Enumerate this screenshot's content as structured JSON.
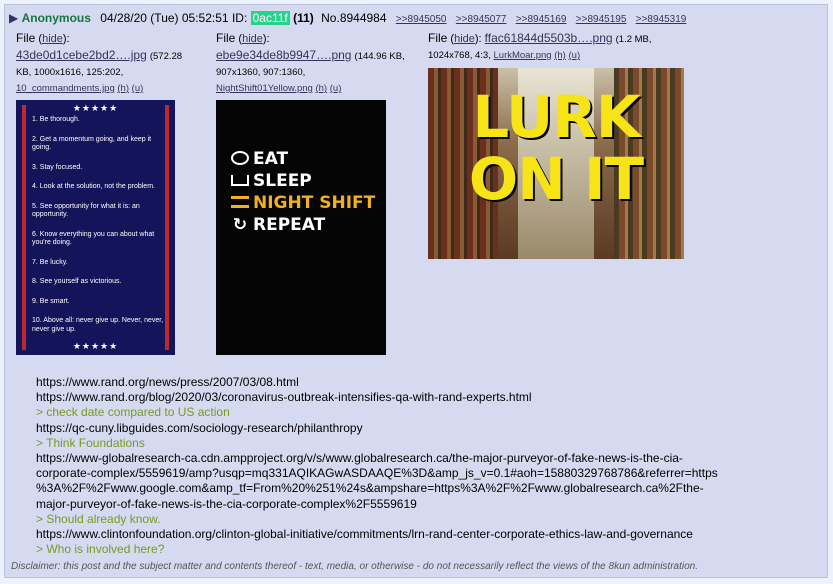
{
  "header": {
    "name": "Anonymous",
    "datetime": "04/28/20 (Tue) 05:52:51",
    "id_label": "ID:",
    "id": "0ac11f",
    "count": "(11)",
    "number": "No.8944984",
    "backlinks": [
      ">>8945050",
      ">>8945077",
      ">>8945169",
      ">>8945195",
      ">>8945319"
    ]
  },
  "files": [
    {
      "label": "File",
      "hide": "hide",
      "filename": "43de0d1cebe2bd2….jpg",
      "meta1": "(572.28",
      "meta2": "KB, 1000x1616, 125:202,",
      "orig": "10_commandments.jpg",
      "h": "(h)",
      "u": "(u)",
      "list": [
        "1. Be thorough.",
        "2. Get a momentum going, and keep it going.",
        "3. Stay focused.",
        "4. Look at the solution, not the problem.",
        "5. See opportunity for what it is: an opportunity.",
        "6. Know everything you can about what you're doing.",
        "7. Be lucky.",
        "8. See yourself as victorious.",
        "9. Be smart.",
        "10. Above all: never give up. Never, never, never give up."
      ],
      "stars": "★★★★★"
    },
    {
      "label": "File",
      "hide": "hide",
      "filename": "ebe9e34de8b9947….png",
      "meta1": "(144.96 KB,",
      "meta2": "907x1360, 907:1360,",
      "orig": "NightShift01Yellow.png",
      "h": "(h)",
      "u": "(u)",
      "lines": [
        "EAT",
        "SLEEP",
        "NIGHT SHIFT",
        "REPEAT"
      ]
    },
    {
      "label": "File",
      "hide": "hide",
      "filename": "ffac61844d5503b….png",
      "meta1": "(1.2 MB,",
      "meta2": "1024x768, 4:3,",
      "orig": "LurkMoar.png",
      "h": "(h)",
      "u": "(u)",
      "line1": "LURK",
      "line2": "ON IT"
    }
  ],
  "body_lines": [
    {
      "text": "https://www.rand.org/news/press/2007/03/08.html",
      "quote": false
    },
    {
      "text": "https://www.rand.org/blog/2020/03/coronavirus-outbreak-intensifies-qa-with-rand-experts.html",
      "quote": false
    },
    {
      "text": "> check date compared to US action",
      "quote": true
    },
    {
      "text": "https://qc-cuny.libguides.com/sociology-research/philanthropy",
      "quote": false
    },
    {
      "text": "> Think Foundations",
      "quote": true
    },
    {
      "text": "https://www-globalresearch-ca.cdn.ampproject.org/v/s/www.globalresearch.ca/the-major-purveyor-of-fake-news-is-the-cia-",
      "quote": false
    },
    {
      "text": "corporate-complex/5559619/amp?usqp=mq331AQIKAGwASDAAQE%3D&amp_js_v=0.1#aoh=15880329768786&referrer=https",
      "quote": false
    },
    {
      "text": "%3A%2F%2Fwww.google.com&amp_tf=From%20%251%24s&ampshare=https%3A%2F%2Fwww.globalresearch.ca%2Fthe-",
      "quote": false
    },
    {
      "text": "major-purveyor-of-fake-news-is-the-cia-corporate-complex%2F5559619",
      "quote": false
    },
    {
      "text": "> Should already know.",
      "quote": true
    },
    {
      "text": "https://www.clintonfoundation.org/clinton-global-initiative/commitments/lrn-rand-center-corporate-ethics-law-and-governance",
      "quote": false
    },
    {
      "text": "> Who is involved here?",
      "quote": true
    }
  ],
  "disclaimer": "Disclaimer: this post and the subject matter and contents thereof - text, media, or otherwise - do not necessarily reflect the views of the 8kun administration.",
  "colors": {
    "name": "#117743",
    "quote": "#789922",
    "link": "#34345c",
    "id_bg": "#28d28b",
    "post_bg": "#d6daf0"
  }
}
